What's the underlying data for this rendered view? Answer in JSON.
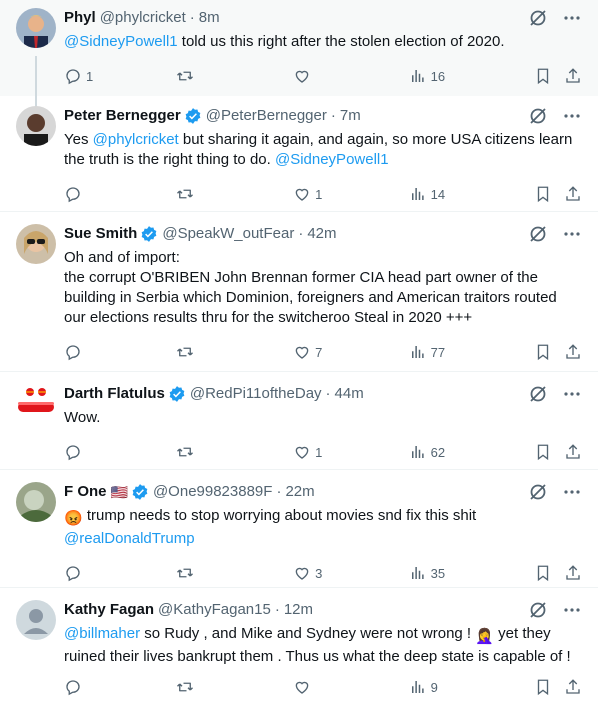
{
  "tweets": [
    {
      "name": "Phyl",
      "handle": "@phylcricket",
      "sep": "·",
      "time": "8m",
      "verified": false,
      "mention1": "@SidneyPowell1",
      "text1": " told us this right after the stolen election of 2020.",
      "replies": "1",
      "retweets": "",
      "likes": "",
      "views": "16"
    },
    {
      "name": "Peter Bernegger",
      "handle": "@PeterBernegger",
      "sep": "·",
      "time": "7m",
      "verified": true,
      "pre": "Yes ",
      "mention1": "@phylcricket",
      "text1": " but sharing it again, and again, so more USA citizens learn the truth is the right thing to do. ",
      "mention2": "@SidneyPowell1",
      "replies": "",
      "retweets": "",
      "likes": "1",
      "views": "14"
    },
    {
      "name": "Sue Smith",
      "handle": "@SpeakW_outFear",
      "sep": "·",
      "time": "42m",
      "verified": true,
      "text1": "Oh and of import:\nthe corrupt O'BRIBEN John Brennan former CIA head part owner of the building in Serbia  which Dominion, foreigners and American traitors routed our elections results thru for the switcheroo Steal in 2020 +++",
      "replies": "",
      "retweets": "",
      "likes": "7",
      "views": "77"
    },
    {
      "name": "Darth Flatulus",
      "handle": "@RedPi11oftheDay",
      "sep": "·",
      "time": "44m",
      "verified": true,
      "text1": "Wow.",
      "replies": "",
      "retweets": "",
      "likes": "1",
      "views": "62"
    },
    {
      "name": "F One",
      "flag": "🇺🇸",
      "handle": "@One99823889F",
      "sep": "·",
      "time": "22m",
      "verified": true,
      "emoji": "😡",
      "text1": " trump needs to stop worrying about movies snd fix this shit",
      "mention2": "@realDonaldTrump",
      "replies": "",
      "retweets": "",
      "likes": "3",
      "views": "35"
    },
    {
      "name": "Kathy Fagan",
      "handle": "@KathyFagan15",
      "sep": "·",
      "time": "12m",
      "verified": false,
      "mention1": "@billmaher",
      "text1": "  so Rudy , and Mike and Sydney were not wrong ! ",
      "emoji": "🤦‍♀️",
      "text2": " yet they ruined their lives bankrupt them . Thus us what the deep state is capable of !",
      "replies": "",
      "retweets": "",
      "likes": "",
      "views": "9"
    }
  ],
  "colors": {
    "accent": "#1d9bf0",
    "muted": "#536471",
    "text": "#0f1419"
  }
}
